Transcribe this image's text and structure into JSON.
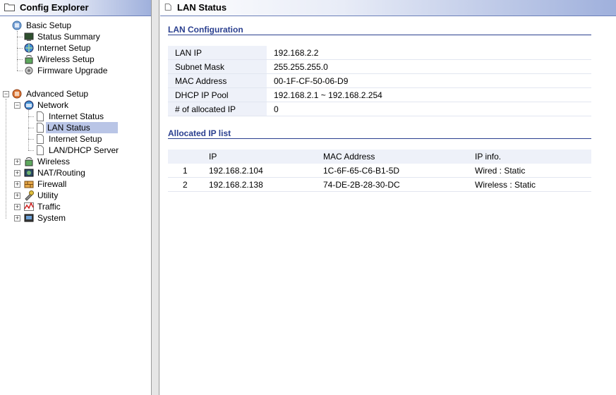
{
  "left_panel": {
    "title": "Config Explorer"
  },
  "right_panel": {
    "title": "LAN Status"
  },
  "tree": {
    "basic_setup": "Basic Setup",
    "status_summary": "Status Summary",
    "internet_setup": "Internet Setup",
    "wireless_setup": "Wireless Setup",
    "firmware_upgrade": "Firmware Upgrade",
    "advanced_setup": "Advanced Setup",
    "network": "Network",
    "net_internet_status": "Internet Status",
    "net_lan_status": "LAN Status",
    "net_internet_setup": "Internet Setup",
    "net_lan_dhcp": "LAN/DHCP Server",
    "wireless": "Wireless",
    "nat_routing": "NAT/Routing",
    "firewall": "Firewall",
    "utility": "Utility",
    "traffic": "Traffic",
    "system": "System"
  },
  "lan_config": {
    "title": "LAN Configuration",
    "rows": [
      {
        "label": "LAN IP",
        "value": "192.168.2.2"
      },
      {
        "label": "Subnet Mask",
        "value": "255.255.255.0"
      },
      {
        "label": "MAC Address",
        "value": "00-1F-CF-50-06-D9"
      },
      {
        "label": "DHCP IP Pool",
        "value": "192.168.2.1 ~  192.168.2.254"
      },
      {
        "label": "# of allocated IP",
        "value": "0"
      }
    ]
  },
  "allocated": {
    "title": "Allocated IP list",
    "headers": {
      "num": "",
      "ip": "IP",
      "mac": "MAC Address",
      "info": "IP info."
    },
    "rows": [
      {
        "num": "1",
        "ip": "192.168.2.104",
        "mac": "1C-6F-65-C6-B1-5D",
        "info": "Wired : Static"
      },
      {
        "num": "2",
        "ip": "192.168.2.138",
        "mac": "74-DE-2B-28-30-DC",
        "info": "Wireless : Static"
      }
    ]
  },
  "colors": {
    "section_title": "#2a3f8f",
    "selected_bg": "#b9c5e6",
    "header_gradient_end": "#9fb0dc"
  }
}
